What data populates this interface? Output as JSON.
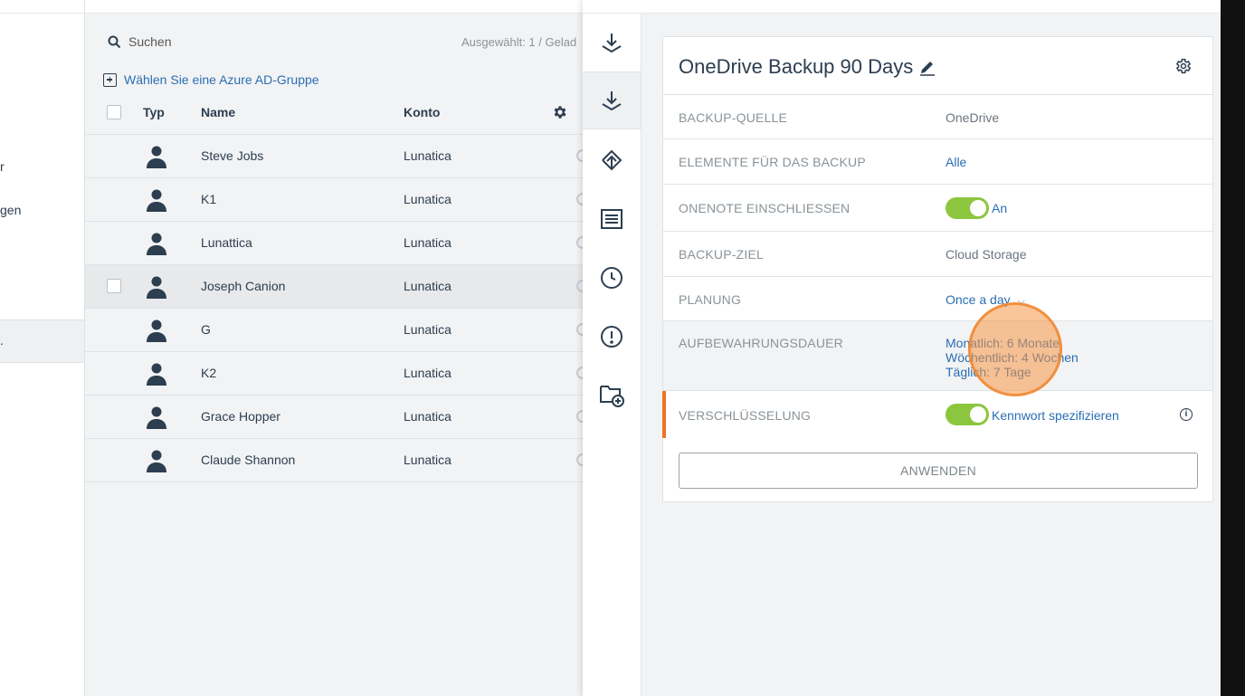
{
  "sidebar": {
    "items": [
      {
        "label": "r"
      },
      {
        "label": "gen"
      },
      {
        "label": "."
      }
    ]
  },
  "list": {
    "search_label": "Suchen",
    "selected_info": "Ausgewählt: 1 / Gelad",
    "azure_link": "Wählen Sie eine Azure AD-Gruppe",
    "columns": {
      "type": "Typ",
      "name": "Name",
      "account": "Konto"
    },
    "rows": [
      {
        "name": "Steve Jobs",
        "account": "Lunatica"
      },
      {
        "name": "K1",
        "account": "Lunatica"
      },
      {
        "name": "Lunattica",
        "account": "Lunatica"
      },
      {
        "name": "Joseph Canion",
        "account": "Lunatica"
      },
      {
        "name": "G",
        "account": "Lunatica"
      },
      {
        "name": "K2",
        "account": "Lunatica"
      },
      {
        "name": "Grace Hopper",
        "account": "Lunatica"
      },
      {
        "name": "Claude Shannon",
        "account": "Lunatica"
      }
    ]
  },
  "rail": {
    "icons": [
      "download-icon",
      "download-icon",
      "recovery-icon",
      "document-icon",
      "clock-icon",
      "alert-icon",
      "add-folder-icon"
    ]
  },
  "plan": {
    "title": "OneDrive Backup 90 Days",
    "rows": {
      "source_label": "BACKUP-QUELLE",
      "source_value": "OneDrive",
      "items_label": "ELEMENTE FÜR DAS BACKUP",
      "items_value": "Alle",
      "onenote_label": "ONENOTE EINSCHLIESSEN",
      "onenote_value": "An",
      "target_label": "BACKUP-ZIEL",
      "target_value": "Cloud Storage",
      "schedule_label": "PLANUNG",
      "schedule_value": "Once a day",
      "retention_label": "AUFBEWAHRUNGSDAUER",
      "retention_monthly": "Monatlich: 6 Monate",
      "retention_weekly": "Wöchentlich: 4 Wochen",
      "retention_daily": "Täglich: 7 Tage",
      "encryption_label": "VERSCHLÜSSELUNG",
      "encryption_value": "Kennwort spezifizieren"
    },
    "apply_label": "ANWENDEN"
  },
  "colors": {
    "accent_link": "#2a6eb5",
    "toggle_on": "#8cc63f",
    "accent_bar": "#e87722",
    "highlight": "#f59646"
  }
}
